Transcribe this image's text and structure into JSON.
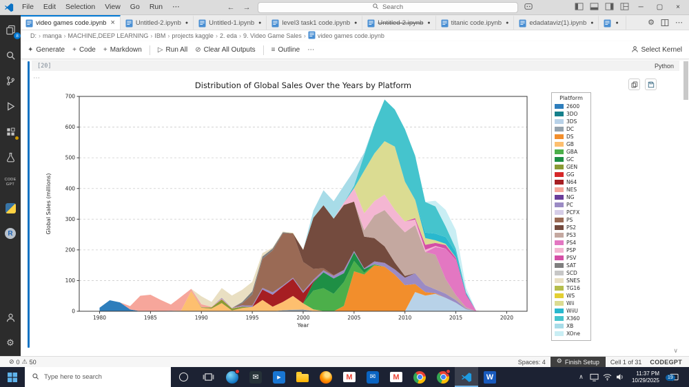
{
  "icons": {
    "back": "←",
    "forward": "→",
    "more": "⋯",
    "minimize": "─",
    "maximize": "▢",
    "close": "×",
    "dot": "●",
    "gear": "⚙",
    "run": "▷",
    "clear": "⊘",
    "outline": "≡",
    "plus": "+",
    "sparkle": "✦",
    "error": "⊘",
    "warning": "⚠",
    "chevron_down": "∨",
    "chevron_up": "∧",
    "crumb_sep": "›",
    "gmail_m": "M",
    "word_w": "W",
    "r_logo": "R",
    "mail_envelope": "✉",
    "play": "▶"
  },
  "titlebar": {
    "menu_items": [
      "File",
      "Edit",
      "Selection",
      "View",
      "Go",
      "Run"
    ],
    "search_label": "Search"
  },
  "tabbar": {
    "tabs": [
      {
        "label": "video games code.ipynb",
        "active": true
      },
      {
        "label": "Untitled-2.ipynb"
      },
      {
        "label": "Untitled-1.ipynb"
      },
      {
        "label": "level3 task1 code.ipynb"
      },
      {
        "label": "Untitled-2.ipynb",
        "deleted": true
      },
      {
        "label": "titanic code.ipynb"
      },
      {
        "label": "edadataviz(1).ipynb"
      }
    ]
  },
  "breadcrumbs": {
    "items": [
      "D:",
      "manga",
      "MACHINE,DEEP LEARNING",
      "IBM",
      "projects kaggle",
      "2. eda",
      "9. Video Game Sales",
      "video games code.ipynb"
    ]
  },
  "notebook_toolbar": {
    "generate": "Generate",
    "add_code": "Code",
    "add_markdown": "Markdown",
    "run_all": "Run All",
    "clear_all_outputs": "Clear All Outputs",
    "outline": "Outline",
    "select_kernel": "Select Kernel"
  },
  "cell": {
    "execution_count": "[20]",
    "language": "Python"
  },
  "activitybar": {
    "explorer_badge": "8",
    "codegpt_label": "CODE GPT"
  },
  "statusbar": {
    "errors": "0",
    "warnings": "50",
    "spaces": "Spaces: 4",
    "finish_setup": "Finish Setup",
    "cell_position": "Cell 1 of 31",
    "codegpt": "CODEGPT"
  },
  "taskbar": {
    "search_placeholder": "Type here to search",
    "time": "11:37 PM",
    "date": "10/29/2025",
    "notification_count": "19"
  },
  "chart_data": {
    "type": "area",
    "stacked": true,
    "title": "Distribution of Global Sales Over the Years by Platform",
    "xlabel": "Year",
    "ylabel": "Global Sales (millions)",
    "legend_title": "Platform",
    "legend_position": "right-outside",
    "grid": "horizontal-dashed",
    "x_start": 1980,
    "x_end": 2020,
    "xlim": [
      1978,
      2022
    ],
    "ylim": [
      0,
      700
    ],
    "xticks": [
      1980,
      1985,
      1990,
      1995,
      2000,
      2005,
      2010,
      2015,
      2020
    ],
    "yticks": [
      0,
      100,
      200,
      300,
      400,
      500,
      600,
      700
    ],
    "series": [
      {
        "name": "2600",
        "color": "#2e7ebc",
        "values": {
          "1980": 11.4,
          "1981": 35.8,
          "1982": 28.9,
          "1983": 5.8,
          "1984": 0.3,
          "1985": 0.5,
          "1986": 0.7,
          "1987": 1.9,
          "1988": 0.7,
          "1989": 0.6
        }
      },
      {
        "name": "3DO",
        "color": "#15808c",
        "values": {
          "1994": 0.1,
          "1995": 0.1
        }
      },
      {
        "name": "3DS",
        "color": "#b8d2e8",
        "values": {
          "2011": 62.5,
          "2012": 51.1,
          "2013": 56.6,
          "2014": 43.8,
          "2015": 27.8,
          "2016": 6.6,
          "2017": 0.1
        }
      },
      {
        "name": "DC",
        "color": "#94a2ad",
        "values": {
          "1998": 3.4,
          "1999": 5.2,
          "2000": 5.7,
          "2001": 1.1,
          "2002": 0.4
        }
      },
      {
        "name": "DS",
        "color": "#f28e2c",
        "values": {
          "2004": 17.3,
          "2005": 130.1,
          "2006": 119.8,
          "2007": 149.4,
          "2008": 145.3,
          "2009": 119.5,
          "2010": 85.0,
          "2011": 26.2,
          "2012": 11.0,
          "2013": 2.0,
          "2020": 0.3
        }
      },
      {
        "name": "GB",
        "color": "#fdbf6f",
        "values": {
          "1988": 1.4,
          "1989": 65.0,
          "1990": 11.2,
          "1991": 8.8,
          "1992": 26.7,
          "1993": 2.4,
          "1994": 10.3,
          "1995": 13.7,
          "1996": 36.9,
          "1997": 14.7,
          "1998": 26.9,
          "1999": 44.9,
          "2000": 20.0,
          "2001": 5.0
        }
      },
      {
        "name": "GBA",
        "color": "#4caf4a",
        "values": {
          "2001": 61.1,
          "2002": 74.8,
          "2003": 56.7,
          "2004": 77.9,
          "2005": 33.9,
          "2006": 5.3,
          "2007": 3.4
        }
      },
      {
        "name": "GC",
        "color": "#1e8f45",
        "values": {
          "2001": 26.3,
          "2002": 51.8,
          "2003": 50.0,
          "2004": 28.8,
          "2005": 27.6,
          "2006": 11.8,
          "2007": 0.3
        }
      },
      {
        "name": "GEN",
        "color": "#8a9a35",
        "values": {
          "1990": 1.8,
          "1991": 3.7,
          "1992": 11.6,
          "1993": 6.7,
          "1994": 4.4
        }
      },
      {
        "name": "GG",
        "color": "#d62728",
        "values": {
          "1992": 0.04
        }
      },
      {
        "name": "N64",
        "color": "#a61e22",
        "values": {
          "1996": 34.1,
          "1997": 39.1,
          "1998": 50.3,
          "1999": 55.8,
          "2000": 34.0,
          "2001": 3.3
        }
      },
      {
        "name": "NES",
        "color": "#f6a69b",
        "values": {
          "1983": 11.0,
          "1984": 50.1,
          "1985": 53.4,
          "1986": 36.4,
          "1987": 19.8,
          "1988": 45.0,
          "1989": 7.3,
          "1990": 9.9,
          "1991": 1.9,
          "1992": 2.3,
          "1993": 1.2,
          "1994": 0.3
        }
      },
      {
        "name": "NG",
        "color": "#6a3d9a",
        "values": {
          "1993": 0.4,
          "1994": 0.6,
          "1995": 0.3,
          "1996": 0.1
        }
      },
      {
        "name": "PC",
        "color": "#9b8bc4",
        "values": {
          "1992": 3.0,
          "1994": 3.5,
          "1995": 4.2,
          "1996": 5.0,
          "1997": 7.9,
          "1998": 3.3,
          "1999": 3.6,
          "2000": 4.7,
          "2001": 5.7,
          "2002": 6.5,
          "2003": 8.6,
          "2004": 10.5,
          "2005": 4.9,
          "2006": 2.9,
          "2007": 9.3,
          "2008": 12.2,
          "2009": 16.9,
          "2010": 24.3,
          "2011": 35.0,
          "2012": 23.2,
          "2013": 12.7,
          "2014": 13.3,
          "2015": 8.5,
          "2016": 2.4
        }
      },
      {
        "name": "PCFX",
        "color": "#d5cde8",
        "values": {
          "1996": 0.03
        }
      },
      {
        "name": "PS",
        "color": "#9a6a55",
        "values": {
          "1994": 6.0,
          "1995": 35.9,
          "1996": 94.7,
          "1997": 136.1,
          "1998": 169.6,
          "1999": 144.6,
          "2000": 96.3,
          "2001": 35.5,
          "2002": 6.7,
          "2003": 2.2
        }
      },
      {
        "name": "PS2",
        "color": "#744b3e",
        "values": {
          "2000": 39.1,
          "2001": 166.4,
          "2002": 205.4,
          "2003": 184.3,
          "2004": 211.8,
          "2005": 160.7,
          "2006": 103.4,
          "2007": 76.0,
          "2008": 53.8,
          "2009": 22.2,
          "2010": 5.6,
          "2011": 0.4
        }
      },
      {
        "name": "PS3",
        "color": "#c4a8a0",
        "values": {
          "2006": 21.1,
          "2007": 73.8,
          "2008": 118.5,
          "2009": 132.3,
          "2010": 142.2,
          "2011": 156.8,
          "2012": 107.4,
          "2013": 113.3,
          "2014": 47.8,
          "2015": 16.5,
          "2016": 3.6
        }
      },
      {
        "name": "PS4",
        "color": "#e377c2",
        "values": {
          "2013": 24.8,
          "2014": 98.8,
          "2015": 115.3,
          "2016": 39.3,
          "2017": 1.3
        }
      },
      {
        "name": "PSP",
        "color": "#f4b6d2",
        "values": {
          "2004": 7.1,
          "2005": 43.8,
          "2006": 55.5,
          "2007": 46.8,
          "2008": 50.2,
          "2009": 39.5,
          "2010": 35.2,
          "2011": 17.8,
          "2012": 7.7,
          "2013": 3.1,
          "2014": 0.2
        }
      },
      {
        "name": "PSV",
        "color": "#d44fa6",
        "values": {
          "2011": 4.8,
          "2012": 16.2,
          "2013": 10.1,
          "2014": 11.9,
          "2015": 6.4,
          "2016": 4.2,
          "2017": 0.2
        }
      },
      {
        "name": "SAT",
        "color": "#7f7f7f",
        "values": {
          "1994": 4.4,
          "1995": 10.9,
          "1996": 7.7,
          "1997": 6.7,
          "1998": 3.9,
          "1999": 0.3
        }
      },
      {
        "name": "SCD",
        "color": "#c7c7c7",
        "values": {
          "1993": 1.5,
          "1994": 0.4
        }
      },
      {
        "name": "SNES",
        "color": "#e9dfc2",
        "values": {
          "1990": 26.1,
          "1991": 16.2,
          "1992": 32.1,
          "1993": 39.2,
          "1994": 39.8,
          "1995": 30.1,
          "1996": 11.1,
          "1997": 3.0,
          "1998": 2.4
        }
      },
      {
        "name": "TG16",
        "color": "#b5bd4c",
        "values": {
          "1995": 0.2
        }
      },
      {
        "name": "WS",
        "color": "#e3cf33",
        "values": {
          "1999": 0.5,
          "2000": 0.4,
          "2001": 0.5
        }
      },
      {
        "name": "Wii",
        "color": "#dbdc92",
        "values": {
          "2006": 137.9,
          "2007": 154.9,
          "2008": 174.2,
          "2009": 206.0,
          "2010": 130.1,
          "2011": 59.7,
          "2012": 21.8,
          "2013": 8.6,
          "2014": 3.8,
          "2015": 1.1
        }
      },
      {
        "name": "WiiU",
        "color": "#29b8ce",
        "values": {
          "2012": 17.8,
          "2013": 21.7,
          "2014": 22.0,
          "2015": 16.4,
          "2016": 4.7
        }
      },
      {
        "name": "X360",
        "color": "#45c4cd",
        "values": {
          "2005": 8.3,
          "2006": 51.7,
          "2007": 95.0,
          "2008": 135.8,
          "2009": 120.9,
          "2010": 171.1,
          "2011": 143.8,
          "2012": 100.1,
          "2013": 88.6,
          "2014": 34.7,
          "2015": 11.9,
          "2016": 1.5
        }
      },
      {
        "name": "XB",
        "color": "#a8dce8",
        "values": {
          "2001": 22.9,
          "2002": 48.8,
          "2003": 56.7,
          "2004": 55.9,
          "2005": 49.2,
          "2006": 7.3,
          "2007": 0.6
        }
      },
      {
        "name": "XOne",
        "color": "#c9eef4",
        "values": {
          "2013": 18.6,
          "2014": 54.1,
          "2015": 60.1,
          "2016": 14.3,
          "2017": 0.2
        }
      }
    ]
  }
}
